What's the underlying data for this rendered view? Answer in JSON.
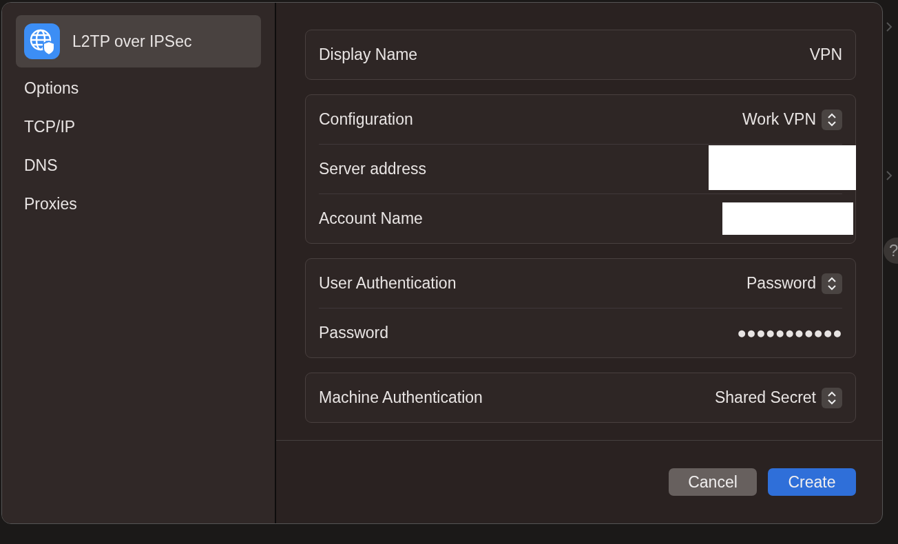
{
  "background": {
    "help_button": "?"
  },
  "sidebar": {
    "items": [
      {
        "label": "L2TP over IPSec",
        "selected": true,
        "kind": "vpn"
      },
      {
        "label": "Options",
        "selected": false
      },
      {
        "label": "TCP/IP",
        "selected": false
      },
      {
        "label": "DNS",
        "selected": false
      },
      {
        "label": "Proxies",
        "selected": false
      }
    ]
  },
  "groups": [
    {
      "rows": [
        {
          "label": "Display Name",
          "kind": "text",
          "value": "VPN"
        }
      ]
    },
    {
      "rows": [
        {
          "label": "Configuration",
          "kind": "popup",
          "value": "Work VPN"
        },
        {
          "label": "Server address",
          "kind": "redacted"
        },
        {
          "label": "Account Name",
          "kind": "redacted"
        }
      ]
    },
    {
      "rows": [
        {
          "label": "User Authentication",
          "kind": "popup",
          "value": "Password"
        },
        {
          "label": "Password",
          "kind": "text",
          "value": "●●●●●●●●●●●"
        }
      ]
    },
    {
      "rows": [
        {
          "label": "Machine Authentication",
          "kind": "popup",
          "value": "Shared Secret"
        }
      ]
    }
  ],
  "buttons": [
    {
      "label": "Cancel",
      "kind": "secondary"
    },
    {
      "label": "Create",
      "kind": "primary"
    }
  ]
}
